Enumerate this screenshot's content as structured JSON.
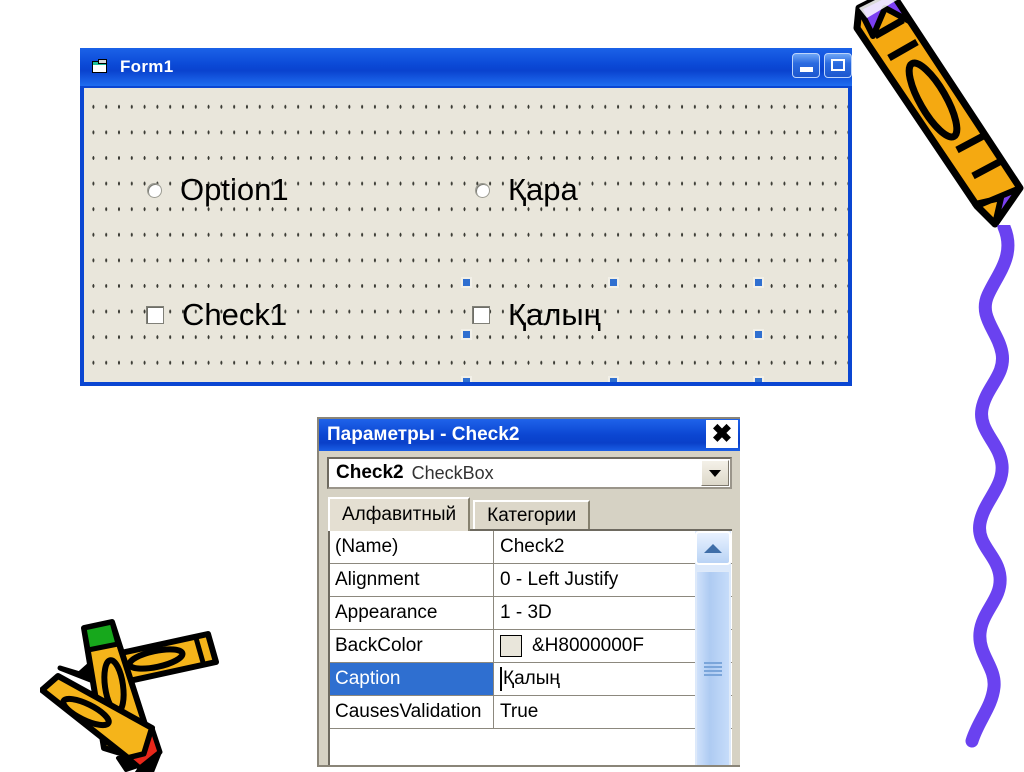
{
  "form_designer": {
    "title": "Form1",
    "icon": "form-document-icon",
    "titlebar_buttons": [
      {
        "name": "minimize-button",
        "glyph": "minimize"
      },
      {
        "name": "maximize-button",
        "glyph": "maximize"
      }
    ],
    "controls": [
      {
        "name": "option-button-1",
        "type": "OptionButton",
        "caption": "Option1",
        "selected": false
      },
      {
        "name": "option-button-2",
        "type": "OptionButton",
        "caption": "Қара",
        "selected": false
      },
      {
        "name": "check-box-1",
        "type": "CheckBox",
        "caption": "Check1",
        "selected": false
      },
      {
        "name": "check-box-2",
        "type": "CheckBox",
        "caption": "Қалың",
        "selected": true
      }
    ],
    "colors": {
      "titlebar": "#0b49d6",
      "client_background": "#e9e6db",
      "selection_handle": "#2f6fd0"
    }
  },
  "properties_window": {
    "title": "Параметры - Check2",
    "close_label": "✖",
    "object_combo": {
      "object_name": "Check2",
      "object_type": "CheckBox"
    },
    "tabs": [
      {
        "label": "Алфавитный",
        "active": true
      },
      {
        "label": "Категории",
        "active": false
      }
    ],
    "grid_rows": [
      {
        "name": "(Name)",
        "value": "Check2",
        "selected": false,
        "swatch": false
      },
      {
        "name": "Alignment",
        "value": "0 - Left Justify",
        "selected": false,
        "swatch": false
      },
      {
        "name": "Appearance",
        "value": "1 - 3D",
        "selected": false,
        "swatch": false
      },
      {
        "name": "BackColor",
        "value": "&H8000000F",
        "selected": false,
        "swatch": true,
        "swatch_color": "#e9e6db"
      },
      {
        "name": "Caption",
        "value": "Қалың",
        "selected": true,
        "swatch": false,
        "editing": true
      },
      {
        "name": "CausesValidation",
        "value": "True",
        "selected": false,
        "swatch": false
      }
    ],
    "scrollbar": {
      "up_arrow": "scroll-up-arrow",
      "thumb": "scroll-thumb"
    },
    "colors": {
      "titlebar": "#0b46d2",
      "selected_row": "#2f6fd0",
      "window_face": "#d6d2c4"
    }
  },
  "decorations": [
    {
      "name": "crayon-orange-purple-tip",
      "colors": {
        "body": "#f5a911",
        "tip": "#7b3ff2",
        "outline": "#000000"
      }
    },
    {
      "name": "crayon-squiggle-purple",
      "colors": {
        "stroke": "#6a42f0"
      }
    },
    {
      "name": "crayons-crossed-group",
      "colors": {
        "body": "#f5b41a",
        "tip_green": "#14a81e",
        "tip_red": "#e8271a",
        "outline": "#000000"
      }
    }
  ]
}
